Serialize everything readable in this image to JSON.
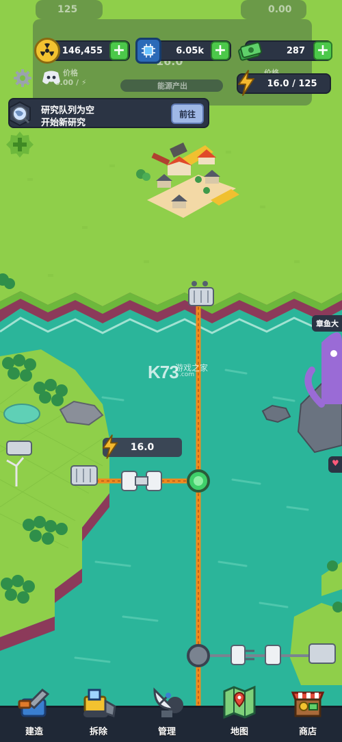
{
  "ghost_hud": {
    "left_value": "125",
    "right_value": "0.00",
    "price_label_left": "价格",
    "price_label_right": "价格",
    "price_value_left": "0.00 / ⚡",
    "dial_value": "16.0",
    "output_label": "能源产出"
  },
  "resources": {
    "nuclear": {
      "value": "146,455",
      "icon": "radiation-icon",
      "color": "#f2c230"
    },
    "chip": {
      "value": "6.05k",
      "icon": "chip-icon",
      "color": "#4aa3e8"
    },
    "cash": {
      "value": "287",
      "icon": "cash-icon",
      "color": "#4cc84a"
    }
  },
  "energy": {
    "value": "16.0 / 125",
    "icon": "lightning-icon",
    "color": "#f5b82e"
  },
  "research": {
    "line1": "研究队列为空",
    "line2": "开始新研究",
    "button": "前往",
    "icon": "globe-icon"
  },
  "side_buttons": [
    {
      "icon": "gear-icon"
    },
    {
      "icon": "discord-icon"
    },
    {
      "icon": "add-icon"
    }
  ],
  "power_node": {
    "value": "16.0",
    "icon": "lightning-icon"
  },
  "right_tag": "章鱼大",
  "watermark": {
    "brand": "K73",
    "subtitle": "游戏之家",
    "url": ".com"
  },
  "nav": [
    {
      "label": "建造",
      "icon": "build-icon"
    },
    {
      "label": "拆除",
      "icon": "bulldozer-icon"
    },
    {
      "label": "管理",
      "icon": "satellite-icon"
    },
    {
      "label": "地图",
      "icon": "map-icon"
    },
    {
      "label": "商店",
      "icon": "shop-icon"
    }
  ],
  "colors": {
    "grass": "#8fcf4a",
    "sea": "#2bb59a",
    "cable": "#f08a1e",
    "panel": "#2b3444",
    "cliff": "#8c3a5a"
  }
}
